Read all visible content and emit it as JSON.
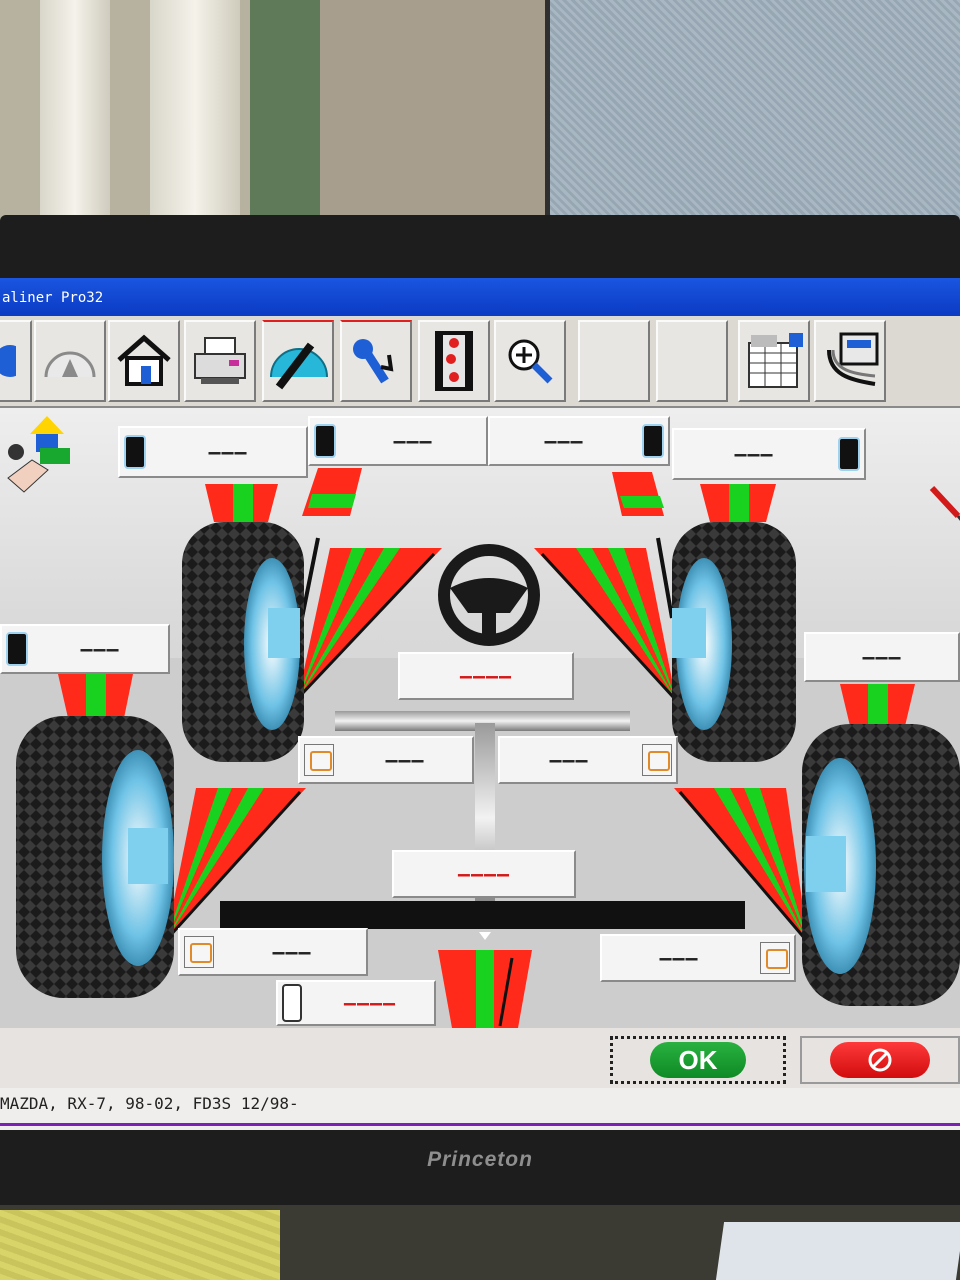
{
  "window": {
    "title": "aliner Pro32"
  },
  "toolbar": {
    "buttons": [
      {
        "icon": "help-icon"
      },
      {
        "icon": "gauge-icon"
      },
      {
        "icon": "home-icon"
      },
      {
        "icon": "printer-icon"
      },
      {
        "icon": "protractor-icon"
      },
      {
        "icon": "wrench-icon"
      },
      {
        "icon": "film-icon"
      },
      {
        "icon": "zoom-in-icon"
      },
      {
        "icon": "blank"
      },
      {
        "icon": "blank"
      },
      {
        "icon": "spreadsheet-icon"
      },
      {
        "icon": "sensor-cable-icon"
      }
    ]
  },
  "readings": {
    "front_left_camber": "———",
    "front_left_caster": "———",
    "front_right_caster": "———",
    "front_right_camber": "———",
    "rear_left_camber": "———",
    "rear_right_camber": "———",
    "front_steering": "————",
    "front_left_toe": "———",
    "front_right_toe": "———",
    "rear_total_toe": "————",
    "rear_left_toe": "———",
    "rear_right_toe": "———",
    "thrust_angle": "————"
  },
  "colors": {
    "gauge_red": "#ff2a1a",
    "gauge_green": "#19d21f",
    "title_blue": "#0b3ac4",
    "status_underline": "#7c1fb5"
  },
  "buttons": {
    "ok_label": "OK"
  },
  "status": {
    "vehicle": "MAZDA, RX-7, 98-02, FD3S 12/98-"
  },
  "monitor": {
    "brand": "Princeton"
  }
}
